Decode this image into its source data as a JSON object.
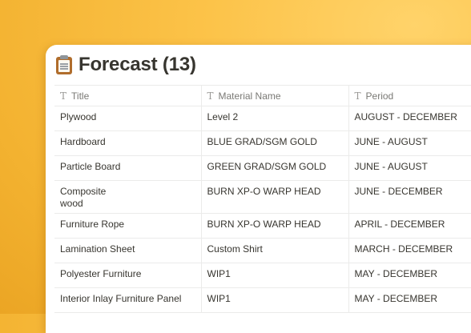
{
  "database": {
    "title": "Forecast (13)",
    "icon": "clipboard-icon"
  },
  "table": {
    "columns": [
      {
        "label": "Title",
        "icon": "text-type-icon"
      },
      {
        "label": "Material Name",
        "icon": "text-type-icon"
      },
      {
        "label": "Period",
        "icon": "text-type-icon"
      }
    ],
    "rows": [
      {
        "title": "Plywood",
        "material": "Level 2",
        "period": "AUGUST - DECEMBER"
      },
      {
        "title": "Hardboard",
        "material": "BLUE GRAD/SGM GOLD",
        "period": "JUNE - AUGUST"
      },
      {
        "title": "Particle Board",
        "material": "GREEN GRAD/SGM GOLD",
        "period": "JUNE - AUGUST"
      },
      {
        "title": "Composite wood",
        "material": "BURN XP-O WARP HEAD",
        "period": "JUNE - DECEMBER"
      },
      {
        "title": "Furniture Rope",
        "material": "BURN XP-O WARP HEAD",
        "period": "APRIL - DECEMBER"
      },
      {
        "title": "Lamination Sheet",
        "material": "Custom Shirt",
        "period": "MARCH - DECEMBER"
      },
      {
        "title": "Polyester Furniture",
        "material": "WIP1",
        "period": "MAY - DECEMBER"
      },
      {
        "title": "Interior Inlay Furniture Panel",
        "material": "WIP1",
        "period": "MAY - DECEMBER"
      }
    ]
  },
  "colors": {
    "background": "#fcc349",
    "text": "#37352f",
    "muted": "#7a7975",
    "border": "#ebebea"
  }
}
